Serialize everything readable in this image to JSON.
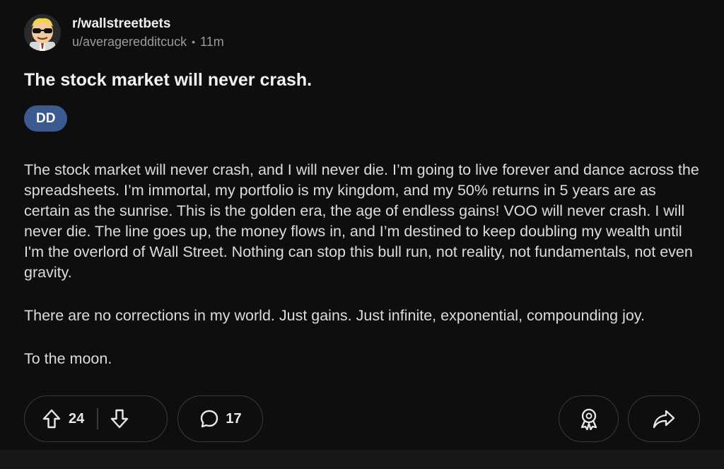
{
  "post": {
    "subreddit": "r/wallstreetbets",
    "author": "u/averageredditcuck",
    "separator": "•",
    "time": "11m",
    "title": "The stock market will never crash.",
    "flair": "DD",
    "paragraphs": [
      "The stock market will never crash, and I will never die. I’m going to live forever and dance across the spreadsheets. I’m immortal, my portfolio is my kingdom, and my 50% returns in 5 years are as certain as the sunrise. This is the golden era, the age of endless gains! VOO will never crash. I will never die. The line goes up, the money flows in, and I’m destined to keep doubling my wealth until I'm the overlord of Wall Street. Nothing can stop this bull run, not reality, not fundamentals, not even gravity.",
      "There are no corrections in my world. Just gains. Just infinite, exponential, compounding joy.",
      "To the moon."
    ]
  },
  "actions": {
    "votes": "24",
    "comments": "17"
  },
  "colors": {
    "background": "#0e0e0e",
    "flair": "#3c5a8f",
    "pill_border": "#3a3a3a"
  },
  "icons": {
    "avatar": "wallstreetbets-avatar",
    "upvote": "arrow-up-icon",
    "downvote": "arrow-down-icon",
    "comment": "speech-bubble-icon",
    "award": "award-ribbon-icon",
    "share": "share-arrow-icon"
  }
}
